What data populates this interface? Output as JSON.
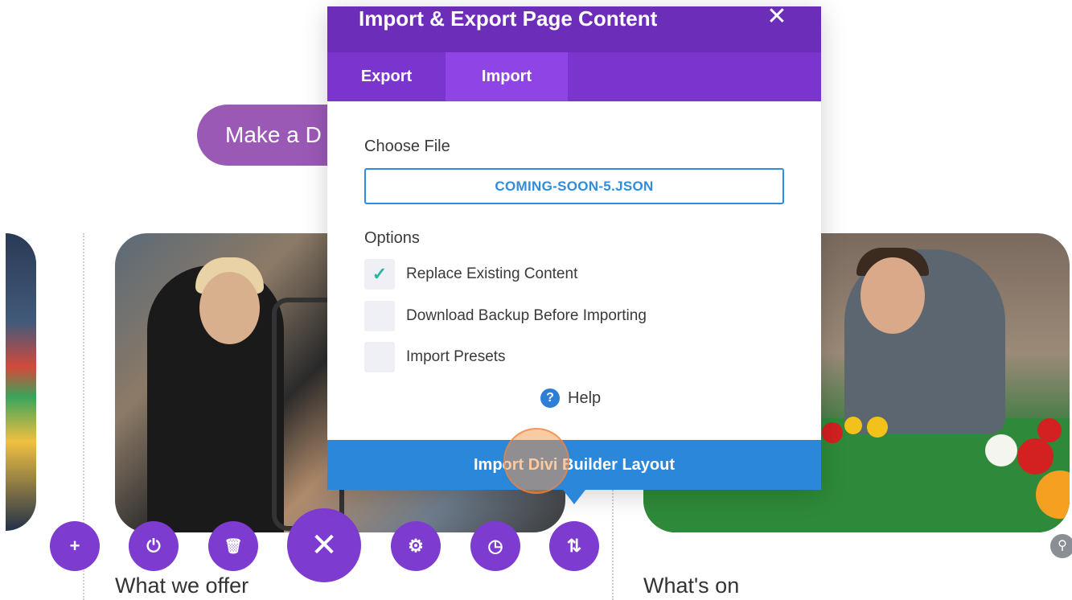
{
  "background": {
    "donate_label": "Make a D",
    "sections": [
      {
        "title": "What we offer"
      },
      {
        "title": "What's on"
      }
    ]
  },
  "toolbar": {
    "buttons": [
      {
        "name": "add",
        "icon": "plus-icon",
        "glyph": "+"
      },
      {
        "name": "power",
        "icon": "power-icon",
        "glyph": "⏻"
      },
      {
        "name": "trash",
        "icon": "trash-icon",
        "glyph": "🗑"
      },
      {
        "name": "close",
        "icon": "close-icon",
        "glyph": "✕"
      },
      {
        "name": "settings",
        "icon": "gear-icon",
        "glyph": "⚙"
      },
      {
        "name": "history",
        "icon": "clock-icon",
        "glyph": "◷"
      },
      {
        "name": "portability",
        "icon": "sort-arrows-icon",
        "glyph": "⇅"
      }
    ]
  },
  "modal": {
    "title": "Import & Export Page Content",
    "close_glyph": "✕",
    "tabs": [
      {
        "label": "Export",
        "active": false
      },
      {
        "label": "Import",
        "active": true
      }
    ],
    "choose_file_label": "Choose File",
    "file_name": "COMING-SOON-5.JSON",
    "options_label": "Options",
    "options": [
      {
        "label": "Replace Existing Content",
        "checked": true
      },
      {
        "label": "Download Backup Before Importing",
        "checked": false
      },
      {
        "label": "Import Presets",
        "checked": false
      }
    ],
    "help_label": "Help",
    "help_glyph": "?",
    "import_button_label": "Import Divi Builder Layout"
  },
  "colors": {
    "header": "#6c2eb9",
    "tabs": "#7b35cf",
    "active_tab": "#8f45e5",
    "primary_blue": "#2b87da",
    "check": "#29b69e",
    "toolbar": "#7e3bd0",
    "donate": "#9b59b6"
  }
}
